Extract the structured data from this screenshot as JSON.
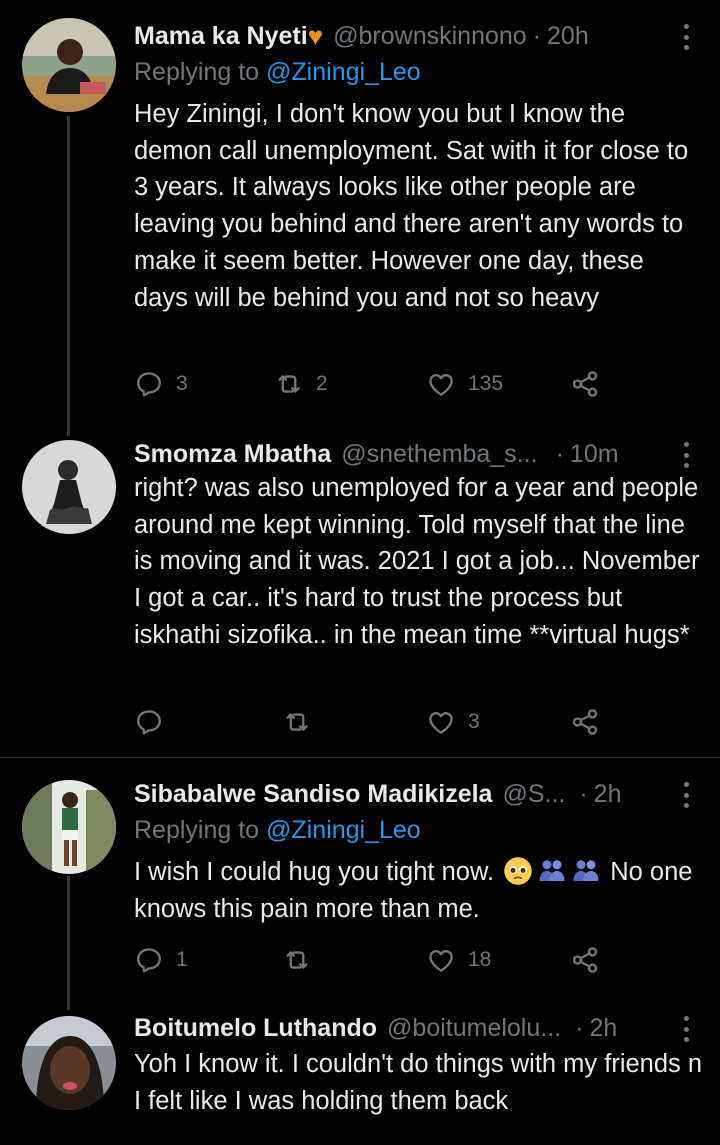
{
  "tweets": [
    {
      "name": "Mama ka Nyeti",
      "handle": "@brownskinnono",
      "time": "20h",
      "replying_prefix": "Replying to ",
      "replying_to": "@Ziningi_Leo",
      "text": "Hey Ziningi, I don't know you but I know the demon call unemployment. Sat with it for close to 3 years. It always looks like other people are leaving you behind and there aren't any words to make it seem better. However one day, these days will be behind you and not so heavy",
      "replies": "3",
      "retweets": "2",
      "likes": "135"
    },
    {
      "name": "Smomza Mbatha",
      "handle": "@snethemba_s...",
      "time": "10m",
      "text": "right? was also unemployed for a year and people around me kept winning. Told myself that the line is moving and it was. 2021 I got a job... November I got a car.. it's hard to trust the process but iskhathi sizofika.. in the mean time **virtual hugs*",
      "replies": "",
      "retweets": "",
      "likes": "3"
    },
    {
      "name": "Sibabalwe Sandiso Madikizela",
      "handle": "@S...",
      "time": "2h",
      "replying_prefix": "Replying to ",
      "replying_to": "@Ziningi_Leo",
      "text_before": "I wish I could hug you tight now.",
      "text_after": "No one knows this pain more than me.",
      "replies": "1",
      "retweets": "",
      "likes": "18"
    },
    {
      "name": "Boitumelo Luthando",
      "handle": "@boitumelolu...",
      "time": "2h",
      "text": "Yoh I know it. I couldn't do things with my friends n I felt like I was holding them back"
    }
  ],
  "separator": "·",
  "name_emoji": "♥",
  "icons": [
    "reply-icon",
    "retweet-icon",
    "like-icon",
    "share-icon",
    "more-icon"
  ],
  "colors": {
    "background": "#000000",
    "text": "#e7e9ea",
    "muted": "#71767b",
    "link": "#1d9bf0"
  }
}
